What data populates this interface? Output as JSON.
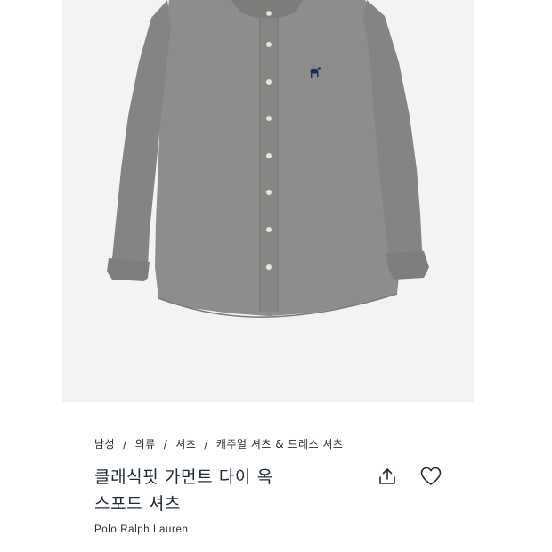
{
  "product_image": {
    "alt": "",
    "background": "#f3f3f3",
    "shirt_color": "#8e8d8b",
    "logo_color": "#1c2a5c"
  },
  "breadcrumb": {
    "items": [
      "남성",
      "의류",
      "셔츠",
      "캐주얼 셔츠 & 드레스 셔츠"
    ],
    "separator": "/"
  },
  "product": {
    "title_line1": "클래식핏 가먼트 다이 옥",
    "title_line2": "스포드 셔츠",
    "brand": "Polo Ralph Lauren"
  },
  "icons": {
    "share": "share-icon",
    "wishlist": "heart-icon"
  }
}
